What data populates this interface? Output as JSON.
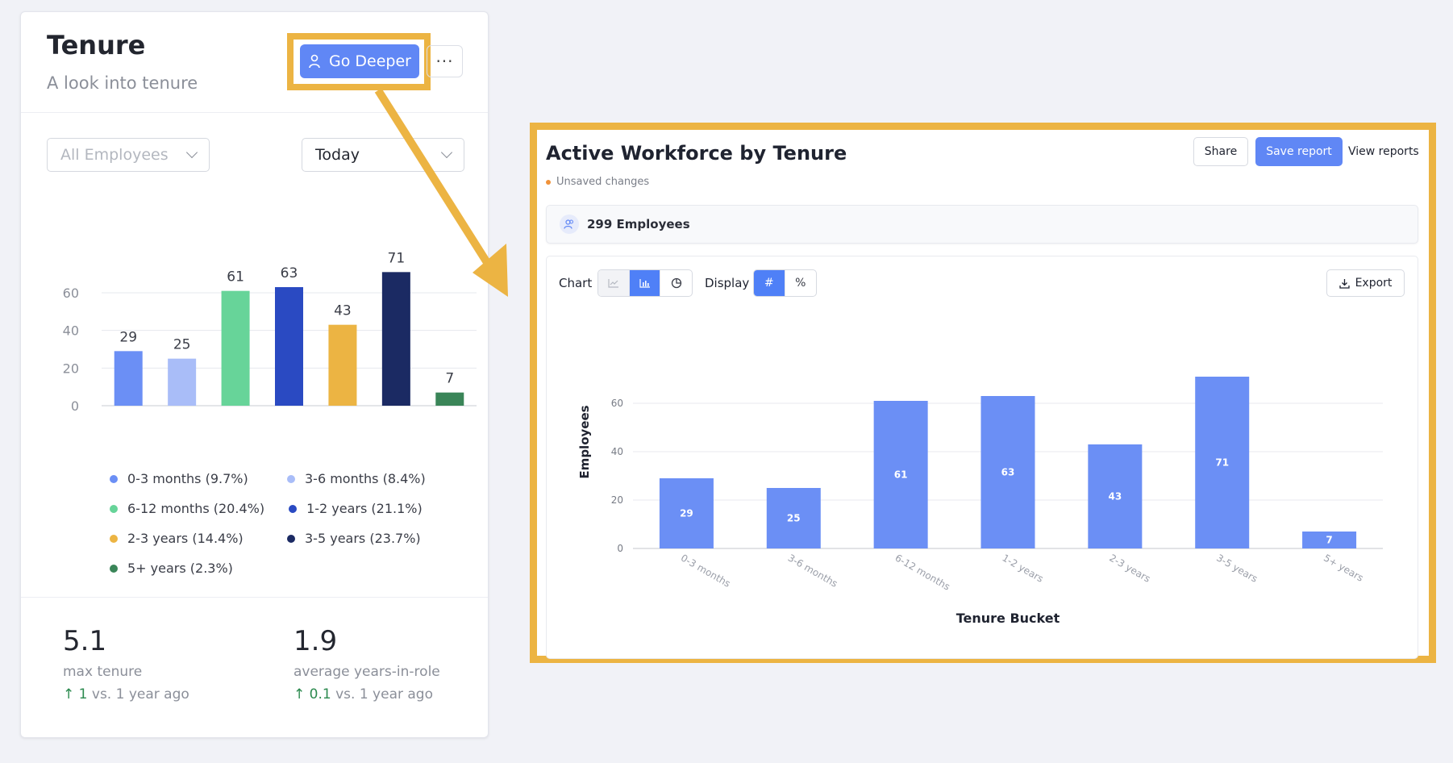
{
  "card": {
    "title": "Tenure",
    "subtitle": "A look into tenure",
    "go_deeper_label": "Go Deeper",
    "more_label": "···",
    "filter_employees": "All Employees",
    "filter_date": "Today",
    "legend": [
      {
        "label": "0-3 months (9.7%)",
        "color": "#6b8ff5"
      },
      {
        "label": "3-6 months (8.4%)",
        "color": "#a9bdf8"
      },
      {
        "label": "6-12 months (20.4%)",
        "color": "#67d499"
      },
      {
        "label": "1-2 years (21.1%)",
        "color": "#2a4ac2"
      },
      {
        "label": "2-3 years (14.4%)",
        "color": "#ecb443"
      },
      {
        "label": "3-5 years (23.7%)",
        "color": "#1b2a63"
      },
      {
        "label": "5+ years (2.3%)",
        "color": "#3a8558"
      }
    ],
    "stats": [
      {
        "value": "5.1",
        "label": "max tenure",
        "delta": "1",
        "compare": "vs. 1 year ago"
      },
      {
        "value": "1.9",
        "label": "average years-in-role",
        "delta": "0.1",
        "compare": "vs. 1 year ago"
      }
    ]
  },
  "panel": {
    "title": "Active Workforce by Tenure",
    "unsaved": "Unsaved changes",
    "share_label": "Share",
    "save_label": "Save report",
    "view_label": "View reports",
    "employees_label": "299 Employees",
    "chart_label": "Chart",
    "display_label": "Display",
    "display_count_symbol": "#",
    "display_percent_symbol": "%",
    "export_label": "Export"
  },
  "colors": {
    "accent": "#6087f5",
    "highlight": "#ecb443",
    "bar": "#6b8ff5",
    "up": "#2c8a4f"
  },
  "chart_data": [
    {
      "type": "bar",
      "categories": [
        "0-3 months",
        "3-6 months",
        "6-12 months",
        "1-2 years",
        "2-3 years",
        "3-5 years",
        "5+ years"
      ],
      "values": [
        29,
        25,
        61,
        63,
        43,
        71,
        7
      ],
      "yticks": [
        0,
        20,
        40,
        60
      ],
      "ylim": [
        0,
        75
      ],
      "colors": [
        "#6b8ff5",
        "#a9bdf8",
        "#67d499",
        "#2a4ac2",
        "#ecb443",
        "#1b2a63",
        "#3a8558"
      ]
    },
    {
      "type": "bar",
      "categories": [
        "0-3 months",
        "3-6 months",
        "6-12 months",
        "1-2 years",
        "2-3 years",
        "3-5 years",
        "5+ years"
      ],
      "values": [
        29,
        25,
        61,
        63,
        43,
        71,
        7
      ],
      "xlabel": "Tenure Bucket",
      "ylabel": "Employees",
      "yticks": [
        0,
        20,
        40,
        60
      ],
      "ylim": [
        0,
        75
      ]
    }
  ]
}
